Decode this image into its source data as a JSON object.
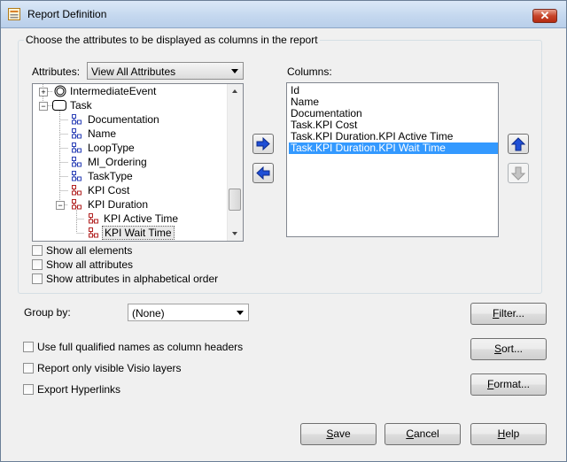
{
  "window": {
    "title": "Report Definition",
    "close_glyph": "✕"
  },
  "group": {
    "legend": "Choose the attributes to be displayed as columns in the report"
  },
  "attributes": {
    "label": "Attributes:",
    "selected": "View All Attributes",
    "tree": [
      {
        "label": "IntermediateEvent",
        "icon": "intermediate-event-icon",
        "level": 0,
        "expander": "+"
      },
      {
        "label": "Task",
        "icon": "task-icon",
        "level": 0,
        "expander": "−"
      },
      {
        "label": "Documentation",
        "icon": "attribute-icon",
        "level": 1
      },
      {
        "label": "Name",
        "icon": "attribute-icon",
        "level": 1
      },
      {
        "label": "LoopType",
        "icon": "attribute-icon",
        "level": 1
      },
      {
        "label": "MI_Ordering",
        "icon": "attribute-icon",
        "level": 1
      },
      {
        "label": "TaskType",
        "icon": "attribute-icon",
        "level": 1
      },
      {
        "label": "KPI Cost",
        "icon": "kpi-attribute-icon",
        "level": 1
      },
      {
        "label": "KPI Duration",
        "icon": "kpi-attribute-icon",
        "level": 1,
        "expander": "−"
      },
      {
        "label": "KPI Active Time",
        "icon": "kpi-attribute-icon",
        "level": 2
      },
      {
        "label": "KPI Wait Time",
        "icon": "kpi-attribute-icon",
        "level": 2,
        "selected": true
      }
    ]
  },
  "columns": {
    "label": "Columns:",
    "items": [
      "Id",
      "Name",
      "Documentation",
      "Task.KPI Cost",
      "Task.KPI Duration.KPI Active Time",
      "Task.KPI Duration.KPI Wait Time"
    ],
    "selected_index": 5
  },
  "options": {
    "show_all_elements": "Show all elements",
    "show_all_attributes": "Show all attributes",
    "show_alpha_order": "Show attributes in alphabetical order"
  },
  "group_by": {
    "label": "Group by:",
    "selected": "(None)"
  },
  "settings": {
    "full_names": "Use full qualified names as column headers",
    "visible_layers": "Report only visible Visio layers",
    "export_hyperlinks": "Export Hyperlinks"
  },
  "buttons": {
    "filter": {
      "pre": "",
      "key": "F",
      "post": "ilter..."
    },
    "sort": {
      "pre": "",
      "key": "S",
      "post": "ort..."
    },
    "format": {
      "pre": "",
      "key": "F",
      "post": "ormat..."
    },
    "save": {
      "pre": "",
      "key": "S",
      "post": "ave"
    },
    "cancel": {
      "pre": "",
      "key": "C",
      "post": "ancel"
    },
    "help": {
      "pre": "",
      "key": "H",
      "post": "elp"
    }
  },
  "colors": {
    "attribute_icon": "#2a3fb6",
    "kpi_icon": "#b22222",
    "selection": "#3399ff",
    "arrow_blue": "#1f4fd6"
  }
}
